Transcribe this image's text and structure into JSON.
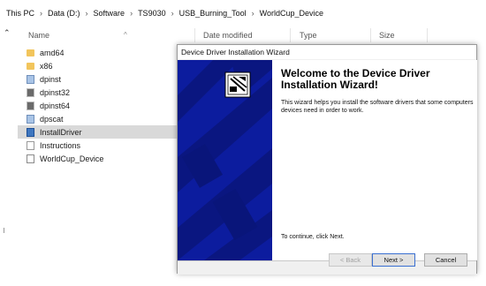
{
  "breadcrumb": [
    "This PC",
    "Data (D:)",
    "Software",
    "TS9030",
    "USB_Burning_Tool",
    "WorldCup_Device"
  ],
  "columns": {
    "name": "Name",
    "date_modified": "Date modified",
    "type": "Type",
    "size": "Size"
  },
  "files": [
    {
      "name": "amd64",
      "icon": "folder-icon"
    },
    {
      "name": "x86",
      "icon": "folder-icon"
    },
    {
      "name": "dpinst",
      "icon": "setup-icon"
    },
    {
      "name": "dpinst32",
      "icon": "executable-icon"
    },
    {
      "name": "dpinst64",
      "icon": "executable-icon"
    },
    {
      "name": "dpscat",
      "icon": "application-icon"
    },
    {
      "name": "InstallDriver",
      "icon": "installer-icon",
      "selected": true
    },
    {
      "name": "Instructions",
      "icon": "text-document-icon"
    },
    {
      "name": "WorldCup_Device",
      "icon": "security-catalog-icon"
    }
  ],
  "wizard": {
    "title": "Device Driver Installation Wizard",
    "heading": "Welcome to the Device Driver Installation Wizard!",
    "description": "This wizard helps you install the software drivers that some computers devices need in order to work.",
    "continue_text": "To continue, click Next.",
    "back_label": "< Back",
    "next_label": "Next >",
    "cancel_label": "Cancel",
    "banner_color": "#0c1c9e"
  }
}
